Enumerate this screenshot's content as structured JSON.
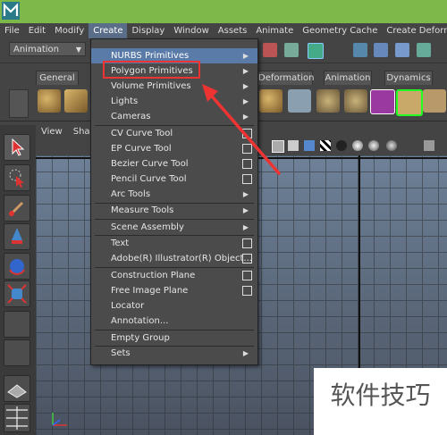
{
  "menubar": {
    "items": [
      "File",
      "Edit",
      "Modify",
      "Create",
      "Display",
      "Window",
      "Assets",
      "Animate",
      "Geometry Cache",
      "Create Deformers"
    ],
    "active": "Create"
  },
  "status_line": {
    "mode_select": "Animation"
  },
  "shelf": {
    "tabs": [
      "General",
      "Deformation",
      "Animation",
      "Dynamics"
    ]
  },
  "panel_menu": [
    "View",
    "Shad"
  ],
  "create_menu": {
    "items": [
      {
        "label": "NURBS Primitives",
        "type": "submenu",
        "highlight": true
      },
      {
        "label": "Polygon Primitives",
        "type": "submenu"
      },
      {
        "label": "Volume Primitives",
        "type": "submenu"
      },
      {
        "label": "Lights",
        "type": "submenu"
      },
      {
        "label": "Cameras",
        "type": "submenu"
      },
      {
        "label": "CV Curve Tool",
        "type": "option"
      },
      {
        "label": "EP Curve Tool",
        "type": "option"
      },
      {
        "label": "Bezier Curve Tool",
        "type": "option"
      },
      {
        "label": "Pencil Curve Tool",
        "type": "option"
      },
      {
        "label": "Arc Tools",
        "type": "submenu"
      },
      {
        "label": "Measure Tools",
        "type": "submenu"
      },
      {
        "label": "Scene Assembly",
        "type": "submenu"
      },
      {
        "label": "Text",
        "type": "option"
      },
      {
        "label": "Adobe(R) Illustrator(R) Object...",
        "type": "option"
      },
      {
        "label": "Construction Plane",
        "type": "option"
      },
      {
        "label": "Free Image Plane",
        "type": "option"
      },
      {
        "label": "Locator",
        "type": "plain"
      },
      {
        "label": "Annotation...",
        "type": "plain"
      },
      {
        "label": "Empty Group",
        "type": "plain"
      },
      {
        "label": "Sets",
        "type": "submenu"
      }
    ]
  },
  "watermark": "软件技巧",
  "colors": {
    "titlebar": "#7fb84a",
    "menu_highlight": "#5a7aa8",
    "annotation_red": "#e33333"
  }
}
